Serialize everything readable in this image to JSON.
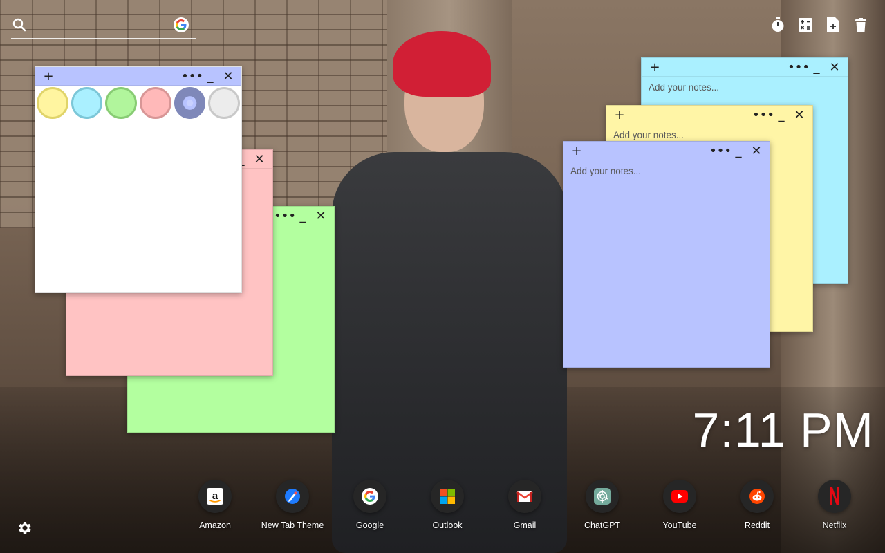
{
  "search": {
    "placeholder": "",
    "icon": "search-icon",
    "engine_icon": "google-icon"
  },
  "top_tools": [
    {
      "name": "timer-icon"
    },
    {
      "name": "calculator-icon"
    },
    {
      "name": "new-note-icon"
    },
    {
      "name": "trash-icon"
    }
  ],
  "notes": {
    "placeholder": "Add your notes...",
    "colors": {
      "white": "#ffffff",
      "pink": "#ffc3c3",
      "green": "#b3ff9f",
      "cyan": "#aaf0ff",
      "yellow": "#fff5a6",
      "blue": "#b8c3ff"
    },
    "palette": [
      {
        "name": "yellow",
        "fill": "#fff5a0",
        "ring": "#e0d46a"
      },
      {
        "name": "cyan",
        "fill": "#aaf0ff",
        "ring": "#7cc7d8"
      },
      {
        "name": "green",
        "fill": "#b1f59c",
        "ring": "#88cc74"
      },
      {
        "name": "pink",
        "fill": "#ffb9b9",
        "ring": "#d89696"
      },
      {
        "name": "blue",
        "fill": "#b8c3ff",
        "ring": "#7f88b9",
        "selected": true
      },
      {
        "name": "gray",
        "fill": "#ececec",
        "ring": "#c9c9c9"
      }
    ]
  },
  "clock": {
    "time": "7:11 PM"
  },
  "dock": [
    {
      "label": "Amazon",
      "icon": "amazon-icon"
    },
    {
      "label": "New Tab Theme",
      "icon": "new-tab-theme-icon"
    },
    {
      "label": "Google",
      "icon": "google-icon"
    },
    {
      "label": "Outlook",
      "icon": "microsoft-icon"
    },
    {
      "label": "Gmail",
      "icon": "gmail-icon"
    },
    {
      "label": "ChatGPT",
      "icon": "chatgpt-icon"
    },
    {
      "label": "YouTube",
      "icon": "youtube-icon"
    },
    {
      "label": "Reddit",
      "icon": "reddit-icon"
    },
    {
      "label": "Netflix",
      "icon": "netflix-icon"
    }
  ],
  "settings": {
    "icon": "gear-icon"
  }
}
